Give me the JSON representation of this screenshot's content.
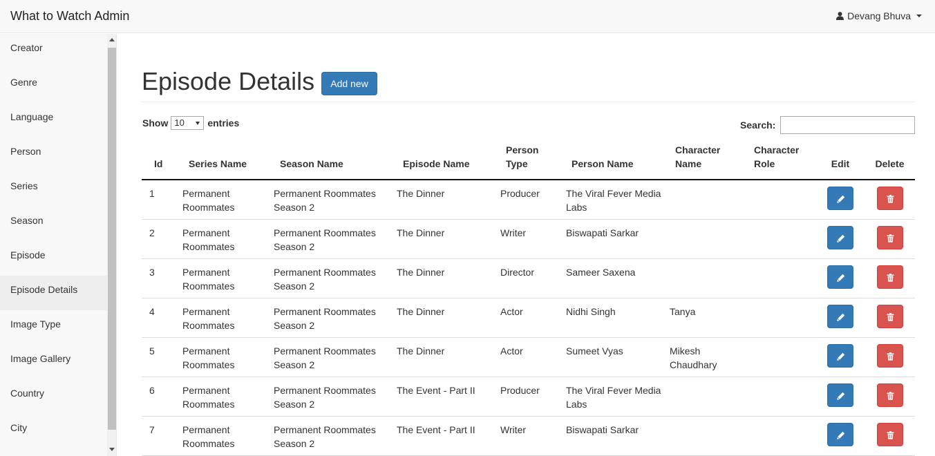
{
  "navbar": {
    "brand": "What to Watch Admin",
    "user": "Devang Bhuva"
  },
  "sidebar": {
    "active": "Episode Details",
    "items": [
      {
        "label": "Creator"
      },
      {
        "label": "Genre"
      },
      {
        "label": "Language"
      },
      {
        "label": "Person"
      },
      {
        "label": "Series"
      },
      {
        "label": "Season"
      },
      {
        "label": "Episode"
      },
      {
        "label": "Episode Details"
      },
      {
        "label": "Image Type"
      },
      {
        "label": "Image Gallery"
      },
      {
        "label": "Country"
      },
      {
        "label": "City"
      }
    ]
  },
  "page": {
    "title": "Episode Details",
    "add_button": "Add new"
  },
  "table_controls": {
    "show_label": "Show",
    "entries_value": "10",
    "entries_label": "entries",
    "search_label": "Search:",
    "search_value": ""
  },
  "table": {
    "headers": [
      "Id",
      "Series Name",
      "Season Name",
      "Episode Name",
      "Person Type",
      "Person Name",
      "Character Name",
      "Character Role",
      "Edit",
      "Delete"
    ],
    "rows": [
      {
        "id": "1",
        "series": "Permanent Roommates",
        "season": "Permanent Roommates Season 2",
        "episode": "The Dinner",
        "person_type": "Producer",
        "person_name": "The Viral Fever Media Labs",
        "character_name": "",
        "character_role": ""
      },
      {
        "id": "2",
        "series": "Permanent Roommates",
        "season": "Permanent Roommates Season 2",
        "episode": "The Dinner",
        "person_type": "Writer",
        "person_name": "Biswapati Sarkar",
        "character_name": "",
        "character_role": ""
      },
      {
        "id": "3",
        "series": "Permanent Roommates",
        "season": "Permanent Roommates Season 2",
        "episode": "The Dinner",
        "person_type": "Director",
        "person_name": "Sameer Saxena",
        "character_name": "",
        "character_role": ""
      },
      {
        "id": "4",
        "series": "Permanent Roommates",
        "season": "Permanent Roommates Season 2",
        "episode": "The Dinner",
        "person_type": "Actor",
        "person_name": "Nidhi Singh",
        "character_name": "Tanya",
        "character_role": ""
      },
      {
        "id": "5",
        "series": "Permanent Roommates",
        "season": "Permanent Roommates Season 2",
        "episode": "The Dinner",
        "person_type": "Actor",
        "person_name": "Sumeet Vyas",
        "character_name": "Mikesh Chaudhary",
        "character_role": ""
      },
      {
        "id": "6",
        "series": "Permanent Roommates",
        "season": "Permanent Roommates Season 2",
        "episode": "The Event - Part II",
        "person_type": "Producer",
        "person_name": "The Viral Fever Media Labs",
        "character_name": "",
        "character_role": ""
      },
      {
        "id": "7",
        "series": "Permanent Roommates",
        "season": "Permanent Roommates Season 2",
        "episode": "The Event - Part II",
        "person_type": "Writer",
        "person_name": "Biswapati Sarkar",
        "character_name": "",
        "character_role": ""
      }
    ]
  },
  "icons": {
    "user": "user-icon",
    "edit": "pencil-icon",
    "delete": "trash-icon"
  },
  "colors": {
    "primary": "#337ab7",
    "danger": "#d9534f",
    "navbar_bg": "#f8f8f8"
  }
}
